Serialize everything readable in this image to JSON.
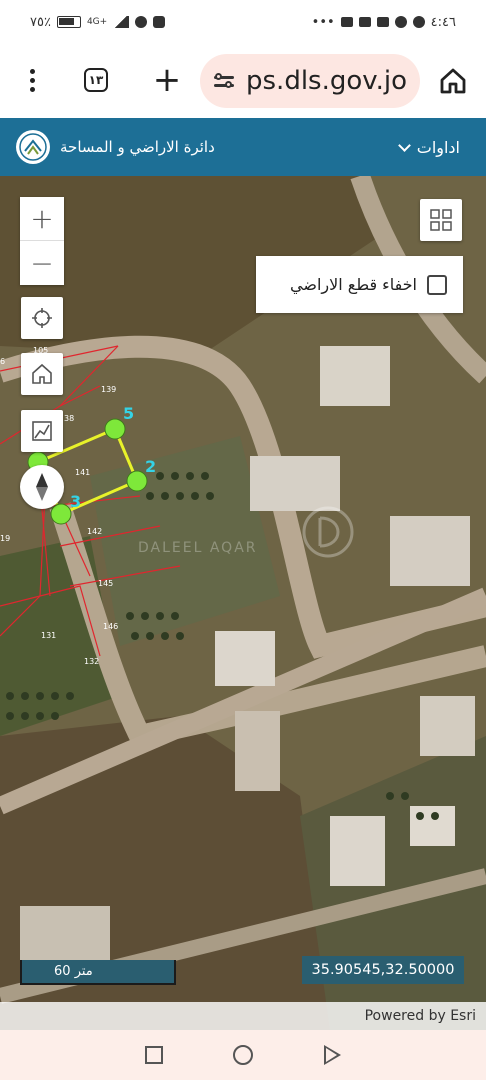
{
  "status_bar": {
    "battery_percent": "٧٥٪",
    "network": "4G+",
    "time": "٤:٤٦"
  },
  "browser": {
    "menu_icon": "more-vert-icon",
    "tab_count": "١٣",
    "url": "ps.dls.gov.jo",
    "home_icon": "home-icon"
  },
  "header": {
    "tools_label": "اداوات",
    "site_title": "دائرة الاراضي و المساحة"
  },
  "map": {
    "hide_parcels_label": "اخفاء قطع الاراضي",
    "hide_parcels_checked": false,
    "parcel_numbers": [
      "105",
      "139",
      "38",
      "141",
      "142",
      "145",
      "146",
      "131",
      "132",
      "19",
      "6"
    ],
    "vertex_labels": [
      "5",
      "2",
      "3"
    ],
    "scale_label": "60 متر",
    "coordinates": "35.90545,32.50000",
    "attribution": "Powered by Esri",
    "watermark": "DALEEL AQAR",
    "colors": {
      "parcel_line": "#e0262e",
      "measure_line": "#e8f22a",
      "vertex_fill": "#7ee83a",
      "vertex_label": "#34d3e6"
    }
  },
  "nav": {
    "back": "square-icon",
    "home": "circle-icon",
    "recent": "triangle-icon"
  }
}
